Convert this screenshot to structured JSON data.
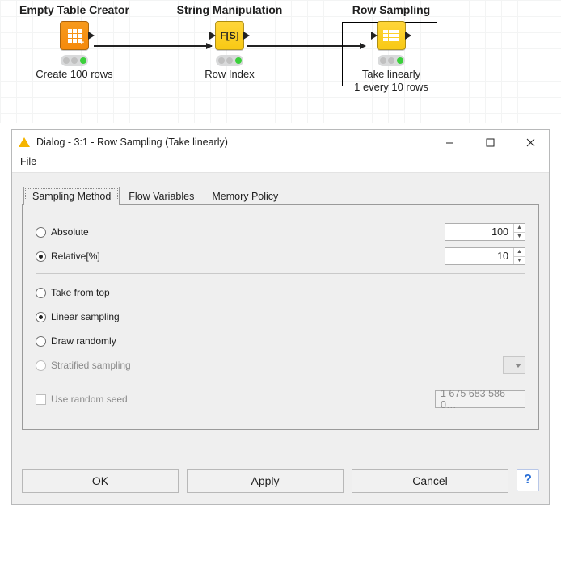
{
  "workflow": {
    "nodes": [
      {
        "category": "Empty Table Creator",
        "label": "Create 100 rows",
        "color": "orange",
        "icon": "grid-plus",
        "hasIn": false,
        "hasOut": true,
        "selected": false
      },
      {
        "category": "String Manipulation",
        "label": "Row Index",
        "color": "yellow",
        "icon": "fs",
        "hasIn": true,
        "hasOut": true,
        "selected": false
      },
      {
        "category": "Row Sampling",
        "label": "Take linearly\n1 every 10 rows",
        "color": "yellow",
        "icon": "rows",
        "hasIn": true,
        "hasOut": true,
        "selected": true
      }
    ]
  },
  "dialog": {
    "title": "Dialog - 3:1 - Row Sampling (Take linearly)",
    "menu": {
      "file": "File"
    },
    "tabs": [
      "Sampling Method",
      "Flow Variables",
      "Memory Policy"
    ],
    "active_tab": 0,
    "size_mode": {
      "absolute": {
        "label": "Absolute",
        "selected": false,
        "value": "100"
      },
      "relative": {
        "label": "Relative[%]",
        "selected": true,
        "value": "10"
      }
    },
    "strategy": {
      "top": {
        "label": "Take from top",
        "selected": false
      },
      "linear": {
        "label": "Linear sampling",
        "selected": true
      },
      "random": {
        "label": "Draw randomly",
        "selected": false
      },
      "strat": {
        "label": "Stratified sampling",
        "selected": false,
        "disabled": true
      }
    },
    "seed": {
      "label": "Use random seed",
      "checked": false,
      "value": "1 675 683 586 0…",
      "disabled": true
    },
    "buttons": {
      "ok": "OK",
      "apply": "Apply",
      "cancel": "Cancel"
    }
  }
}
